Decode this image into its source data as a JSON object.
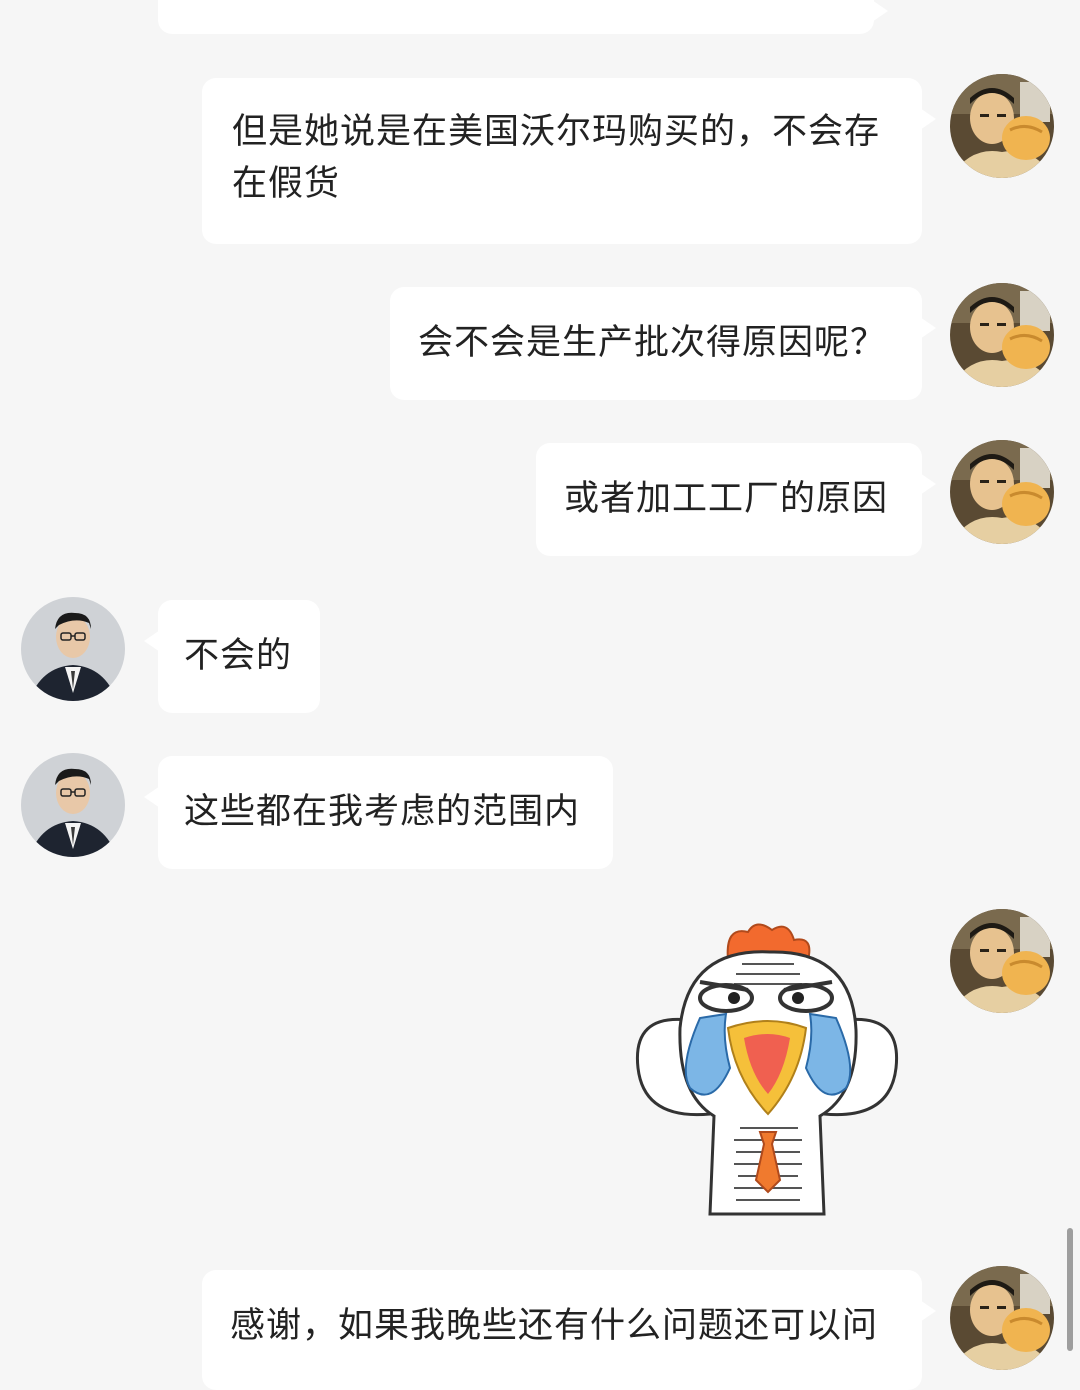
{
  "messages": [
    {
      "id": "m0",
      "side": "right",
      "text": ""
    },
    {
      "id": "m1",
      "side": "right",
      "text": "但是她说是在美国沃尔玛购买的，不会存在假货"
    },
    {
      "id": "m2",
      "side": "right",
      "text": "会不会是生产批次得原因呢？"
    },
    {
      "id": "m3",
      "side": "right",
      "text": "或者加工工厂的原因"
    },
    {
      "id": "m4",
      "side": "left",
      "text": "不会的"
    },
    {
      "id": "m5",
      "side": "left",
      "text": "这些都在我考虑的范围内"
    },
    {
      "id": "m6",
      "side": "right",
      "type": "sticker",
      "sticker": "crying-chicken-sticker"
    },
    {
      "id": "m7",
      "side": "right",
      "text": "感谢，如果我晚些还有什么问题还可以问"
    }
  ],
  "colors": {
    "background": "#f6f6f6",
    "bubble": "#ffffff",
    "text": "#222222"
  }
}
